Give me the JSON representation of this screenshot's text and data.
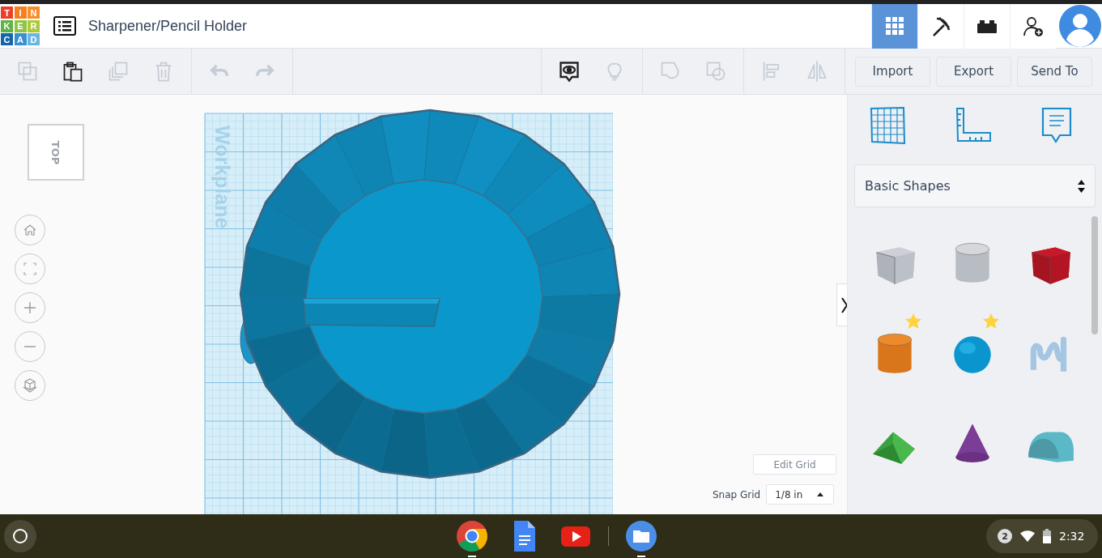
{
  "logo": {
    "letters": [
      {
        "char": "T",
        "color": "#e8402b"
      },
      {
        "char": "I",
        "color": "#f4801f"
      },
      {
        "char": "N",
        "color": "#f68d2e"
      },
      {
        "char": "K",
        "color": "#5fb246"
      },
      {
        "char": "E",
        "color": "#8dc63f"
      },
      {
        "char": "R",
        "color": "#a9cb3b"
      },
      {
        "char": "C",
        "color": "#1565ad"
      },
      {
        "char": "A",
        "color": "#3890d4"
      },
      {
        "char": "D",
        "color": "#6ab5e4"
      }
    ]
  },
  "document": {
    "title": "Sharpener/Pencil Holder"
  },
  "header_buttons": [
    {
      "kind": "grid",
      "selected": true
    },
    {
      "kind": "pickaxe",
      "selected": false
    },
    {
      "kind": "bricks",
      "selected": false
    },
    {
      "kind": "add-user",
      "selected": false
    }
  ],
  "toolbar": {
    "left_groups": [
      {
        "tools": [
          {
            "kind": "copy",
            "disabled": true
          },
          {
            "kind": "paste",
            "disabled": false
          },
          {
            "kind": "duplicate",
            "disabled": true
          },
          {
            "kind": "delete",
            "disabled": true
          }
        ]
      },
      {
        "tools": [
          {
            "kind": "undo",
            "disabled": true
          },
          {
            "kind": "redo",
            "disabled": true
          }
        ]
      }
    ],
    "right_groups": [
      {
        "tools": [
          {
            "kind": "note",
            "disabled": false
          },
          {
            "kind": "bulb",
            "disabled": true
          }
        ]
      },
      {
        "tools": [
          {
            "kind": "group",
            "disabled": true
          },
          {
            "kind": "ungroup",
            "disabled": true
          }
        ]
      },
      {
        "tools": [
          {
            "kind": "align",
            "disabled": true
          },
          {
            "kind": "mirror",
            "disabled": true
          }
        ]
      }
    ],
    "actions": [
      "Import",
      "Export",
      "Send To"
    ]
  },
  "view_controls": {
    "view_cube": "TOP",
    "buttons": [
      {
        "kind": "home"
      },
      {
        "kind": "fit"
      },
      {
        "kind": "zoom-in"
      },
      {
        "kind": "zoom-out"
      },
      {
        "kind": "perspective"
      }
    ]
  },
  "workplane": {
    "label": "Workplane"
  },
  "grid": {
    "edit_button": "Edit Grid",
    "snap_label": "Snap Grid",
    "snap_value": "1/8 in"
  },
  "panel": {
    "tools": [
      {
        "kind": "workplane"
      },
      {
        "kind": "ruler"
      },
      {
        "kind": "notes"
      }
    ],
    "category": "Basic Shapes",
    "shapes": [
      {
        "kind": "box-hole",
        "starred": false
      },
      {
        "kind": "cylinder-hole",
        "starred": false
      },
      {
        "kind": "box",
        "starred": false
      },
      {
        "kind": "cylinder",
        "starred": true
      },
      {
        "kind": "sphere",
        "starred": true
      },
      {
        "kind": "scribble",
        "starred": false
      },
      {
        "kind": "roof",
        "starred": false
      },
      {
        "kind": "cone",
        "starred": false
      },
      {
        "kind": "round-roof",
        "starred": false
      }
    ]
  },
  "taskbar": {
    "apps": [
      {
        "kind": "chrome",
        "running": true
      },
      {
        "kind": "docs",
        "running": false
      },
      {
        "kind": "youtube",
        "running": false
      },
      {
        "kind": "files",
        "running": true
      }
    ],
    "notifications": "2",
    "time": "2:32"
  }
}
